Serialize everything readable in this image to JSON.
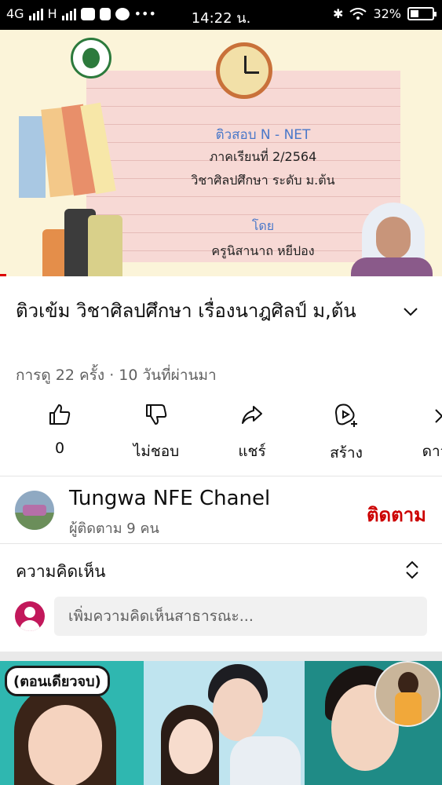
{
  "status_bar": {
    "network_1": "4G",
    "network_2": "H",
    "time": "14:22 น.",
    "battery": "32%"
  },
  "video": {
    "slide": {
      "line1": "ติวสอบ N - NET",
      "line2": "ภาคเรียนที่ 2/2564",
      "line3": "วิชาศิลปศึกษา ระดับ ม.ต้น",
      "line4": "โดย",
      "line5": "ครูนิสานาถ  หยีปอง"
    },
    "progress_fraction": 0.015
  },
  "title": "ติวเข้ม วิชาศิลปศึกษา เรื่องนาฎศิลป์ ม,ต้น",
  "meta": "การดู 22 ครั้ง · 10 วันที่ผ่านมา",
  "actions": [
    {
      "icon": "like-icon",
      "label": "0"
    },
    {
      "icon": "dislike-icon",
      "label": "ไม่ชอบ"
    },
    {
      "icon": "share-icon",
      "label": "แชร์"
    },
    {
      "icon": "create-icon",
      "label": "สร้าง"
    },
    {
      "icon": "download-icon",
      "label": "ดาวน์"
    }
  ],
  "channel": {
    "name": "Tungwa NFE Chanel",
    "subscribers": "ผู้ติดตาม 9 คน",
    "subscribe_label": "ติดตาม"
  },
  "comments": {
    "label": "ความคิดเห็น",
    "placeholder": "เพิ่มความคิดเห็นสาธารณะ..."
  },
  "next_video": {
    "badge": "(ตอนเดียวจบ)"
  },
  "colors": {
    "accent_red": "#cc0000",
    "secondary_text": "#606060",
    "avatar_pink": "#c2185b"
  }
}
